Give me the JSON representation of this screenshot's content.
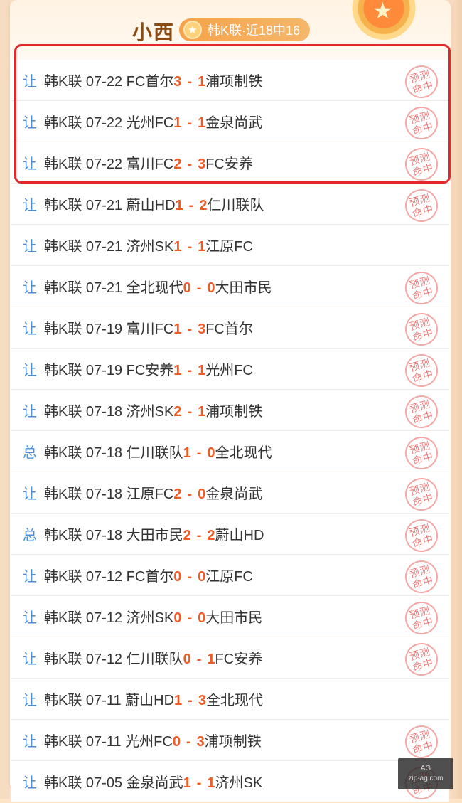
{
  "header": {
    "name": "小西",
    "tag": "韩K联·近18中16",
    "star_icon": "star-icon"
  },
  "stamp_text": {
    "line1": "预测",
    "line2": "命中"
  },
  "watermark": {
    "line1": "AG",
    "line2": "zip-ag.com"
  },
  "matches": [
    {
      "type": "让",
      "league": "韩K联",
      "date": "07-22",
      "home": "FC首尔",
      "hs": "3",
      "as": "1",
      "away": "浦项制铁",
      "hit": true
    },
    {
      "type": "让",
      "league": "韩K联",
      "date": "07-22",
      "home": "光州FC",
      "hs": "1",
      "as": "1",
      "away": "金泉尚武",
      "hit": true
    },
    {
      "type": "让",
      "league": "韩K联",
      "date": "07-22",
      "home": "富川FC",
      "hs": "2",
      "as": "3",
      "away": "FC安养",
      "hit": true
    },
    {
      "type": "让",
      "league": "韩K联",
      "date": "07-21",
      "home": "蔚山HD",
      "hs": "1",
      "as": "2",
      "away": "仁川联队",
      "hit": true
    },
    {
      "type": "让",
      "league": "韩K联",
      "date": "07-21",
      "home": "济州SK",
      "hs": "1",
      "as": "1",
      "away": "江原FC",
      "hit": false
    },
    {
      "type": "让",
      "league": "韩K联",
      "date": "07-21",
      "home": "全北现代",
      "hs": "0",
      "as": "0",
      "away": "大田市民",
      "hit": true
    },
    {
      "type": "让",
      "league": "韩K联",
      "date": "07-19",
      "home": "富川FC",
      "hs": "1",
      "as": "3",
      "away": "FC首尔",
      "hit": true
    },
    {
      "type": "让",
      "league": "韩K联",
      "date": "07-19",
      "home": "FC安养",
      "hs": "1",
      "as": "1",
      "away": "光州FC",
      "hit": true
    },
    {
      "type": "让",
      "league": "韩K联",
      "date": "07-18",
      "home": "济州SK",
      "hs": "2",
      "as": "1",
      "away": "浦项制铁",
      "hit": true
    },
    {
      "type": "总",
      "league": "韩K联",
      "date": "07-18",
      "home": "仁川联队",
      "hs": "1",
      "as": "0",
      "away": "全北现代",
      "hit": true
    },
    {
      "type": "让",
      "league": "韩K联",
      "date": "07-18",
      "home": "江原FC",
      "hs": "2",
      "as": "0",
      "away": "金泉尚武",
      "hit": true
    },
    {
      "type": "总",
      "league": "韩K联",
      "date": "07-18",
      "home": "大田市民",
      "hs": "2",
      "as": "2",
      "away": "蔚山HD",
      "hit": true
    },
    {
      "type": "让",
      "league": "韩K联",
      "date": "07-12",
      "home": "FC首尔",
      "hs": "0",
      "as": "0",
      "away": "江原FC",
      "hit": true
    },
    {
      "type": "让",
      "league": "韩K联",
      "date": "07-12",
      "home": "济州SK",
      "hs": "0",
      "as": "0",
      "away": "大田市民",
      "hit": true
    },
    {
      "type": "让",
      "league": "韩K联",
      "date": "07-12",
      "home": "仁川联队",
      "hs": "0",
      "as": "1",
      "away": "FC安养",
      "hit": true
    },
    {
      "type": "让",
      "league": "韩K联",
      "date": "07-11",
      "home": "蔚山HD",
      "hs": "1",
      "as": "3",
      "away": "全北现代",
      "hit": false
    },
    {
      "type": "让",
      "league": "韩K联",
      "date": "07-11",
      "home": "光州FC",
      "hs": "0",
      "as": "3",
      "away": "浦项制铁",
      "hit": true
    },
    {
      "type": "让",
      "league": "韩K联",
      "date": "07-05",
      "home": "金泉尚武",
      "hs": "1",
      "as": "1",
      "away": "济州SK",
      "hit": true
    }
  ]
}
